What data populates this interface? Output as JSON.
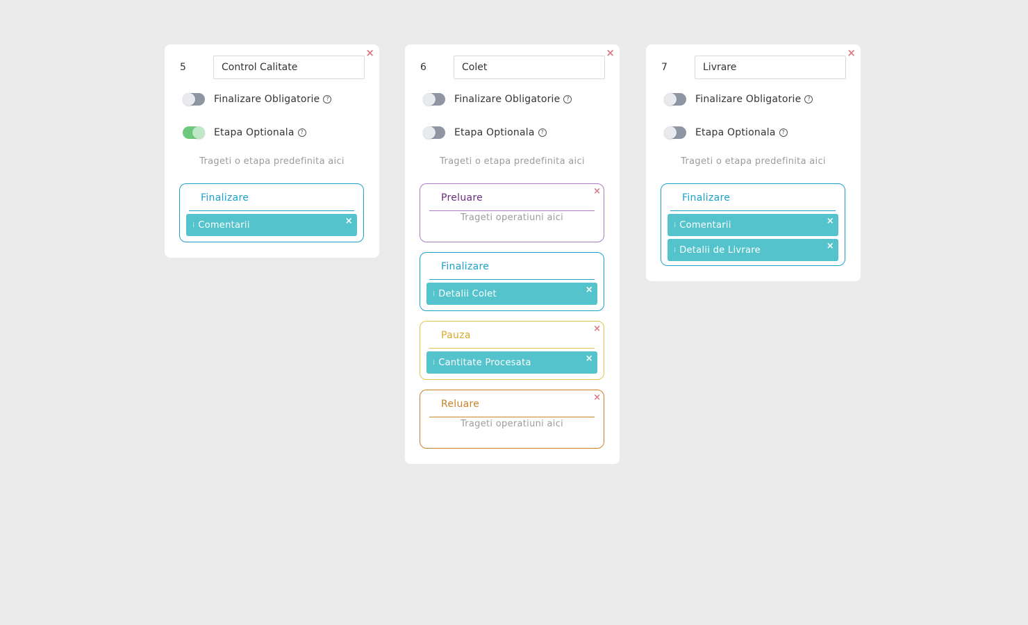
{
  "colors": {
    "finalizare": "#1aa1cb",
    "preluare": "#a87bc2",
    "preluare_text": "#6a2c7f",
    "pauza": "#e7c148",
    "pauza_text": "#d8a92a",
    "reluare": "#c9822a",
    "reluare_text": "#c9822a",
    "operation": "#54c3cc"
  },
  "labels": {
    "toggle_required": "Finalizare Obligatorie",
    "toggle_optional": "Etapa Optionala",
    "drop_stage_hint": "Trageti o etapa predefinita aici",
    "drop_ops_hint": "Trageti operatiuni aici",
    "close_glyph": "×",
    "help_glyph": "?",
    "drag_glyph": "⁞"
  },
  "cards": [
    {
      "number": "5",
      "name": "Control Calitate",
      "required": false,
      "optional": true,
      "stages": [
        {
          "title": "Finalizare",
          "kind": "finalizare",
          "closable": false,
          "operations": [
            "Comentarii"
          ]
        }
      ]
    },
    {
      "number": "6",
      "name": "Colet",
      "required": false,
      "optional": false,
      "stages": [
        {
          "title": "Preluare",
          "kind": "preluare",
          "closable": true,
          "operations": []
        },
        {
          "title": "Finalizare",
          "kind": "finalizare",
          "closable": false,
          "operations": [
            "Detalii Colet"
          ]
        },
        {
          "title": "Pauza",
          "kind": "pauza",
          "closable": true,
          "operations": [
            "Cantitate Procesata"
          ]
        },
        {
          "title": "Reluare",
          "kind": "reluare",
          "closable": true,
          "operations": []
        }
      ]
    },
    {
      "number": "7",
      "name": "Livrare",
      "required": false,
      "optional": false,
      "stages": [
        {
          "title": "Finalizare",
          "kind": "finalizare",
          "closable": false,
          "operations": [
            "Comentarii",
            "Detalii de Livrare"
          ]
        }
      ]
    }
  ]
}
